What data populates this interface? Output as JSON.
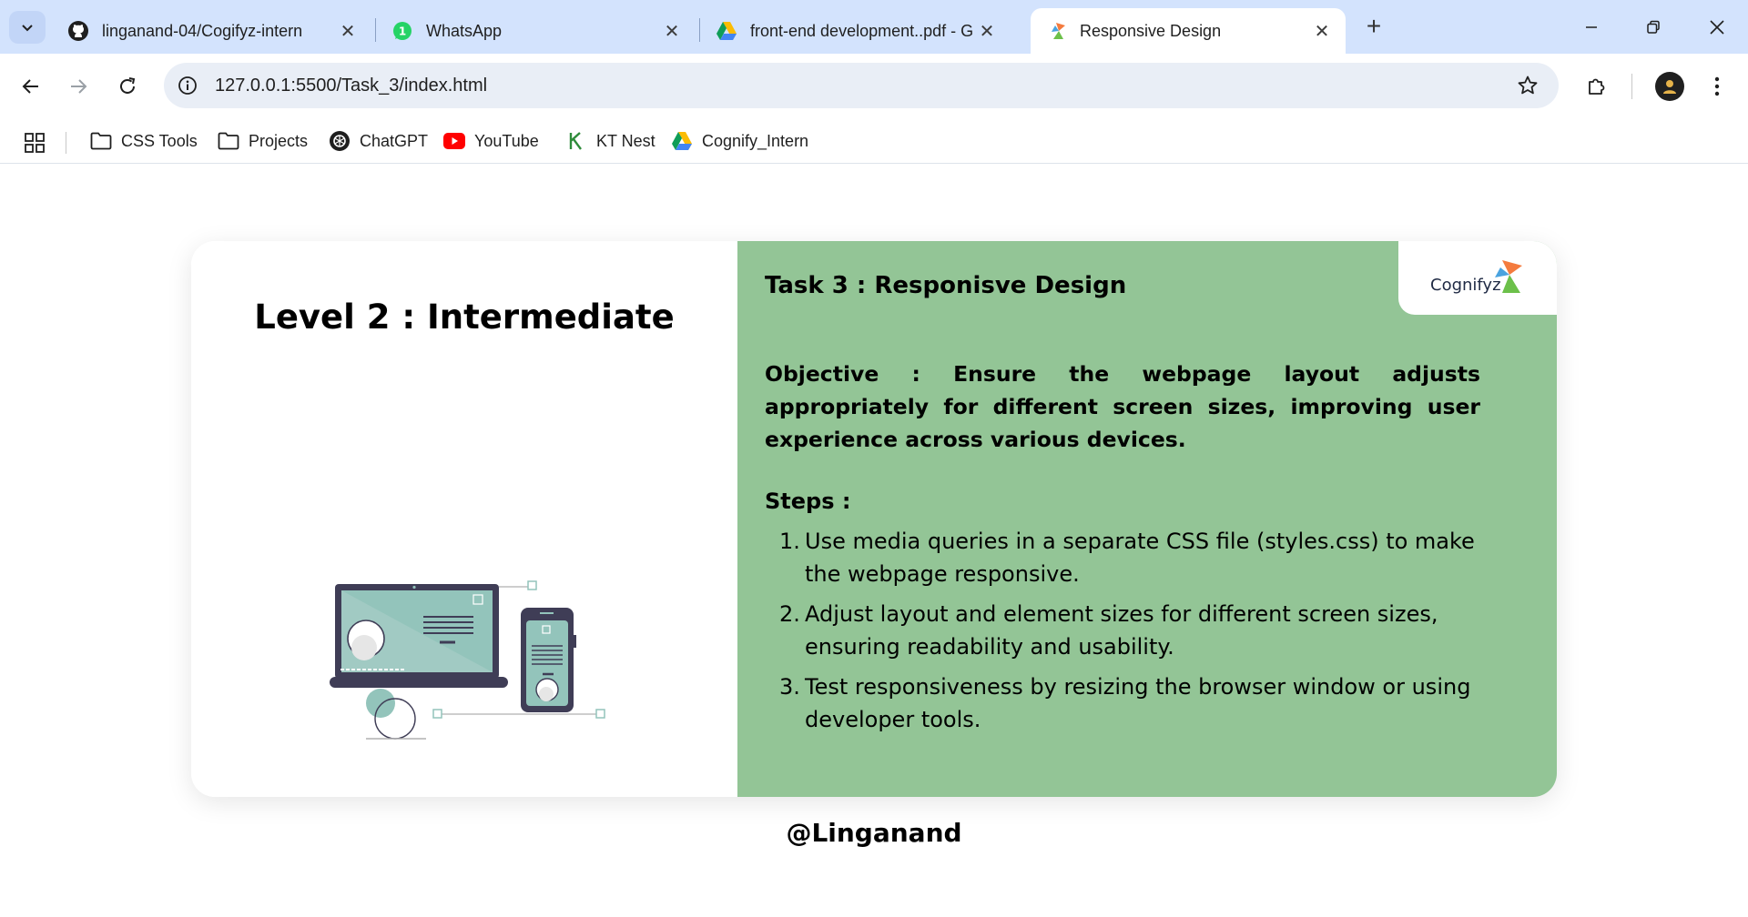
{
  "browser": {
    "tabs": [
      {
        "title": "linganand-04/Cogifyz-intern",
        "icon": "github-icon"
      },
      {
        "title": "WhatsApp",
        "icon": "whatsapp-icon"
      },
      {
        "title": "front-end development..pdf - G",
        "icon": "google-drive-icon"
      },
      {
        "title": "Responsive Design",
        "icon": "cognifyz-icon",
        "active": true
      }
    ],
    "url": "127.0.0.1:5500/Task_3/index.html",
    "bookmarks": [
      {
        "label": "CSS Tools",
        "icon": "folder-icon"
      },
      {
        "label": "Projects",
        "icon": "folder-icon"
      },
      {
        "label": "ChatGPT",
        "icon": "chatgpt-icon"
      },
      {
        "label": "YouTube",
        "icon": "youtube-icon"
      },
      {
        "label": "KT Nest",
        "icon": "kt-nest-icon"
      },
      {
        "label": "Cognify_Intern",
        "icon": "google-drive-icon"
      }
    ]
  },
  "page": {
    "level_title": "Level 2 : Intermediate",
    "logo_text": "Cognifyz",
    "task_title": "Task 3 : Responisve Design",
    "objective": "Objective : Ensure the webpage layout adjusts appropriately for different screen sizes, improving user experience across various devices.",
    "steps_heading": "Steps :",
    "steps": [
      {
        "num": "1.",
        "text": "Use media queries in a separate CSS file (styles.css) to make the webpage responsive."
      },
      {
        "num": "2.",
        "text": "Adjust layout and element sizes for different screen sizes, ensuring readability and usability."
      },
      {
        "num": "3.",
        "text": "Test responsiveness by resizing the browser window or using developer tools."
      }
    ],
    "footer": "@Linganand"
  },
  "colors": {
    "tabstrip": "#d3e3fd",
    "right_panel": "#93c596",
    "illustration_teal": "#93c4bb",
    "illustration_dark": "#3f3d56"
  }
}
